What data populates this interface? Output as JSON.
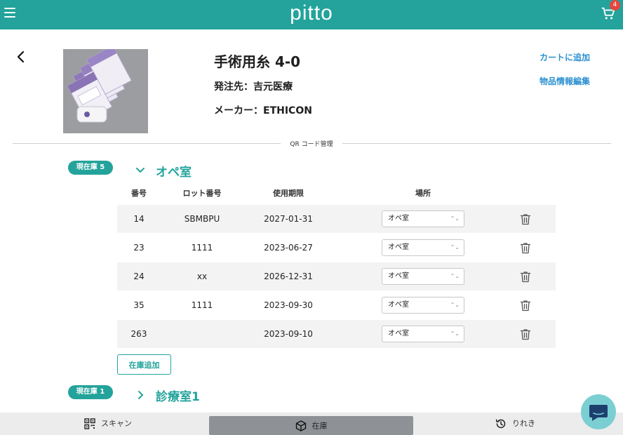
{
  "header": {
    "logo": "pitto",
    "cart_count": "4"
  },
  "product": {
    "title": "手術用糸 4-0",
    "supplier": "発注先：吉元医療",
    "maker": "メーカー：ETHICON",
    "add_to_cart": "カートに追加",
    "edit_info": "物品情報編集"
  },
  "section_label": "QR コード管理",
  "table_headers": {
    "number": "番号",
    "lot": "ロット番号",
    "expiry": "使用期限",
    "location": "場所"
  },
  "locations": [
    {
      "badge": "現在庫 5",
      "name": "オペ室",
      "expanded": true,
      "rows": [
        {
          "number": "14",
          "lot": "SBMBPU",
          "expiry": "2027-01-31",
          "location": "オペ室"
        },
        {
          "number": "23",
          "lot": "1111",
          "expiry": "2023-06-27",
          "location": "オペ室"
        },
        {
          "number": "24",
          "lot": "xx",
          "expiry": "2026-12-31",
          "location": "オペ室"
        },
        {
          "number": "35",
          "lot": "1111",
          "expiry": "2023-09-30",
          "location": "オペ室"
        },
        {
          "number": "263",
          "lot": "",
          "expiry": "2023-09-10",
          "location": "オペ室"
        }
      ],
      "add_stock": "在庫追加"
    },
    {
      "badge": "現在庫 1",
      "name": "診療室1",
      "expanded": false
    }
  ],
  "bottom_nav": {
    "scan": "スキャン",
    "stock": "在庫",
    "history": "りれき"
  },
  "colors": {
    "brand": "#23a39b",
    "link": "#2b8fd0",
    "badge": "#e5473f",
    "active_tab": "#8e9296",
    "chat": "#7bcfd3"
  }
}
